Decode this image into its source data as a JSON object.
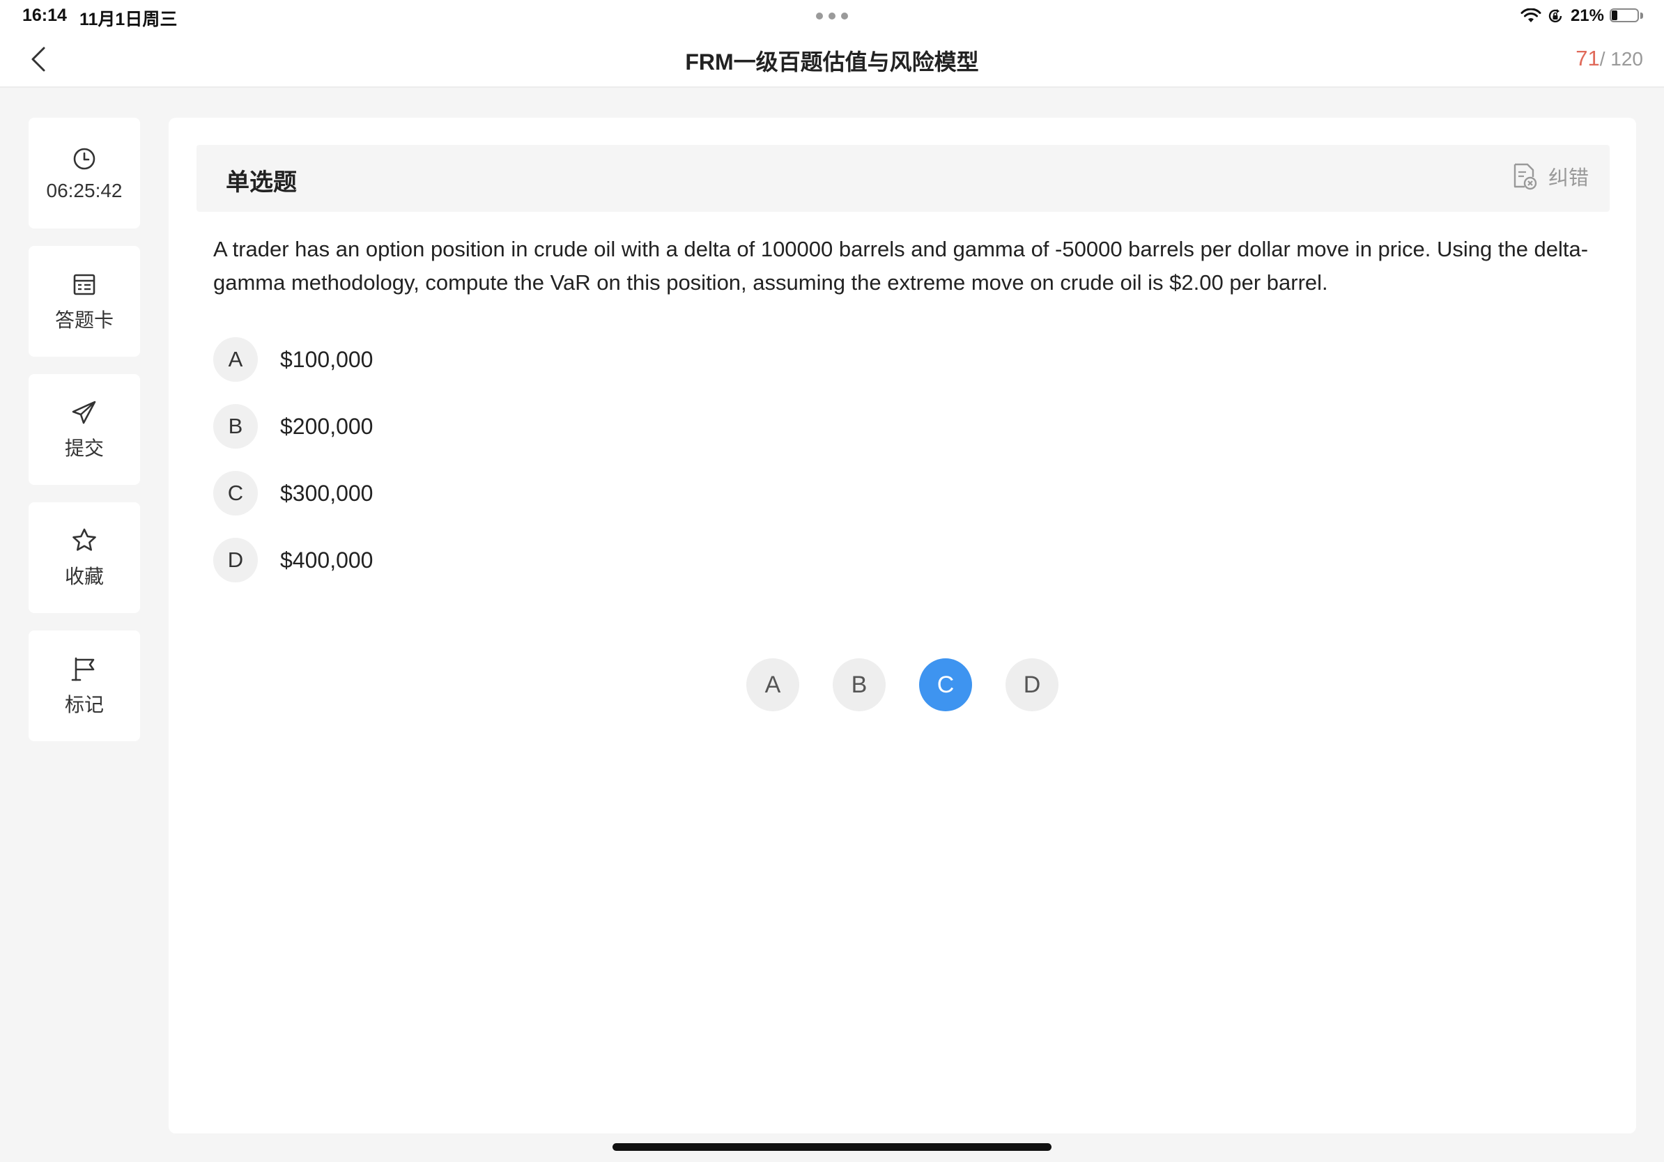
{
  "status_bar": {
    "time": "16:14",
    "date": "11月1日周三",
    "battery_percent": "21%",
    "battery_level": 0.21
  },
  "nav": {
    "title": "FRM一级百题估值与风险模型",
    "progress_current": "71",
    "progress_total": "/ 120"
  },
  "sidebar": {
    "timer": "06:25:42",
    "answer_card": "答题卡",
    "submit": "提交",
    "favorite": "收藏",
    "mark": "标记"
  },
  "question": {
    "type_label": "单选题",
    "correction_label": "纠错",
    "text": "A trader has an option position in crude oil with a delta of 100000 barrels and gamma of -50000 barrels per dollar move in price. Using the delta-gamma methodology, compute the VaR on this position, assuming the extreme move on crude oil is $2.00 per barrel.",
    "options": [
      {
        "letter": "A",
        "text": "$100,000"
      },
      {
        "letter": "B",
        "text": "$200,000"
      },
      {
        "letter": "C",
        "text": "$300,000"
      },
      {
        "letter": "D",
        "text": "$400,000"
      }
    ]
  },
  "answer_choices": [
    "A",
    "B",
    "C",
    "D"
  ],
  "selected_answer": "C",
  "colors": {
    "accent": "#3e94f0",
    "progress_current": "#e06a5a",
    "background": "#f5f5f5"
  }
}
